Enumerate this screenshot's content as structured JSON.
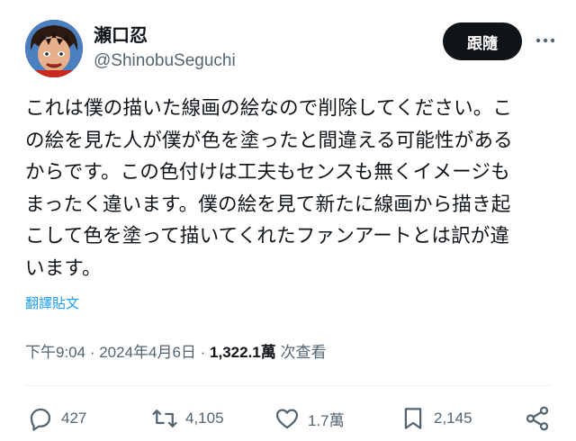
{
  "user": {
    "display_name": "瀬口忍",
    "handle": "@ShinobuSeguchi"
  },
  "header": {
    "follow_label": "跟隨",
    "more_icon": "more-horizontal-icon"
  },
  "tweet": {
    "lines": [
      "これは僕の描いた線画の絵なので削除してください。こ",
      "の絵を見た人が僕が色を塗ったと間違える可能性がある",
      "からです。この色付けは工夫もセンスも無くイメージも",
      "まったく違います。僕の絵を見て新たに線画から描き起",
      "こして色を塗って描いてくれたファンアートとは訳が違",
      "います。"
    ],
    "translate_label": "翻譯貼文"
  },
  "meta": {
    "time": "下午9:04",
    "sep1": " · ",
    "date": "2024年4月6日",
    "sep2": " · ",
    "views_count": "1,322.1萬",
    "views_label": " 次查看"
  },
  "actions": {
    "replies": "427",
    "retweets": "4,105",
    "likes": "1.7萬",
    "bookmarks": "2,145",
    "icons": [
      "reply-icon",
      "retweet-icon",
      "like-icon",
      "bookmark-icon",
      "share-icon"
    ]
  },
  "colors": {
    "text": "#0f1419",
    "secondary": "#536471",
    "link": "#1d9bf0",
    "button_bg": "#0f1419",
    "divider": "#eff3f4"
  }
}
